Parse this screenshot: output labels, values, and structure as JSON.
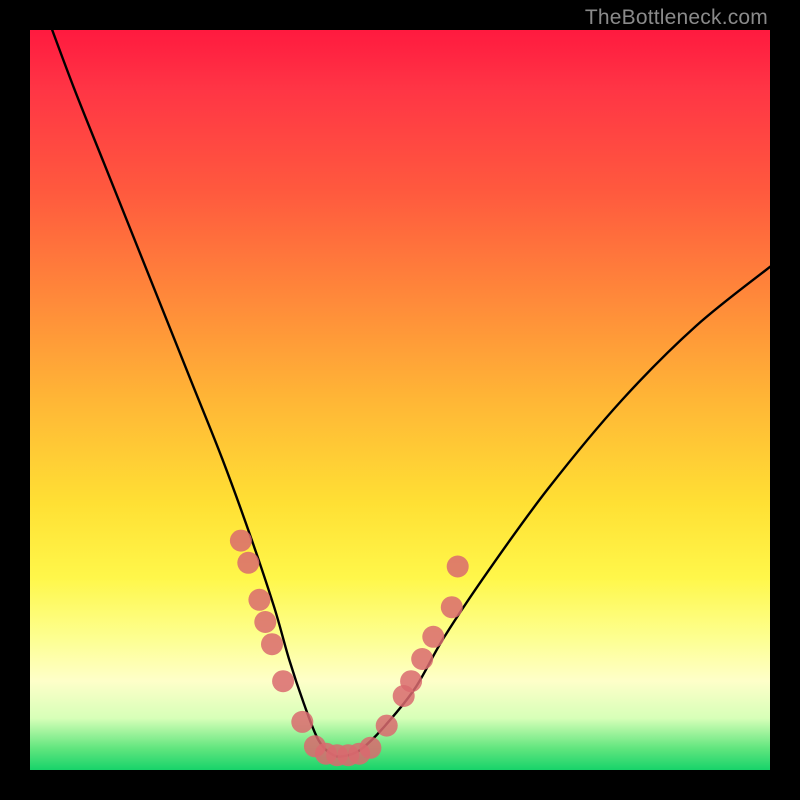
{
  "watermark": "TheBottleneck.com",
  "chart_data": {
    "type": "line",
    "title": "",
    "xlabel": "",
    "ylabel": "",
    "xlim": [
      0,
      100
    ],
    "ylim": [
      0,
      100
    ],
    "grid": false,
    "legend": false,
    "annotations": [],
    "series": [
      {
        "name": "bottleneck-curve",
        "x": [
          3,
          6,
          10,
          14,
          18,
          22,
          26,
          30,
          33,
          35,
          37,
          39,
          41,
          43,
          45,
          48,
          52,
          56,
          62,
          70,
          80,
          90,
          100
        ],
        "y": [
          100,
          92,
          82,
          72,
          62,
          52,
          42,
          31,
          22,
          15,
          9,
          4,
          2,
          2,
          3,
          6,
          11,
          18,
          27,
          38,
          50,
          60,
          68
        ]
      }
    ],
    "markers": [
      {
        "name": "highlight-points",
        "color": "#d96a6e",
        "points": [
          {
            "x": 28.5,
            "y": 31
          },
          {
            "x": 29.5,
            "y": 28
          },
          {
            "x": 31,
            "y": 23
          },
          {
            "x": 31.8,
            "y": 20
          },
          {
            "x": 32.7,
            "y": 17
          },
          {
            "x": 34.2,
            "y": 12
          },
          {
            "x": 36.8,
            "y": 6.5
          },
          {
            "x": 38.5,
            "y": 3.2
          },
          {
            "x": 40,
            "y": 2.2
          },
          {
            "x": 41.5,
            "y": 2
          },
          {
            "x": 43,
            "y": 2
          },
          {
            "x": 44.5,
            "y": 2.2
          },
          {
            "x": 46,
            "y": 3
          },
          {
            "x": 48.2,
            "y": 6
          },
          {
            "x": 50.5,
            "y": 10
          },
          {
            "x": 51.5,
            "y": 12
          },
          {
            "x": 53,
            "y": 15
          },
          {
            "x": 54.5,
            "y": 18
          },
          {
            "x": 57,
            "y": 22
          },
          {
            "x": 57.8,
            "y": 27.5
          }
        ]
      }
    ],
    "background_gradient": {
      "stops": [
        {
          "pos": 0.0,
          "color": "#ff1a3f"
        },
        {
          "pos": 0.36,
          "color": "#ff883a"
        },
        {
          "pos": 0.64,
          "color": "#ffe034"
        },
        {
          "pos": 0.88,
          "color": "#feffc9"
        },
        {
          "pos": 1.0,
          "color": "#17d36a"
        }
      ]
    }
  }
}
